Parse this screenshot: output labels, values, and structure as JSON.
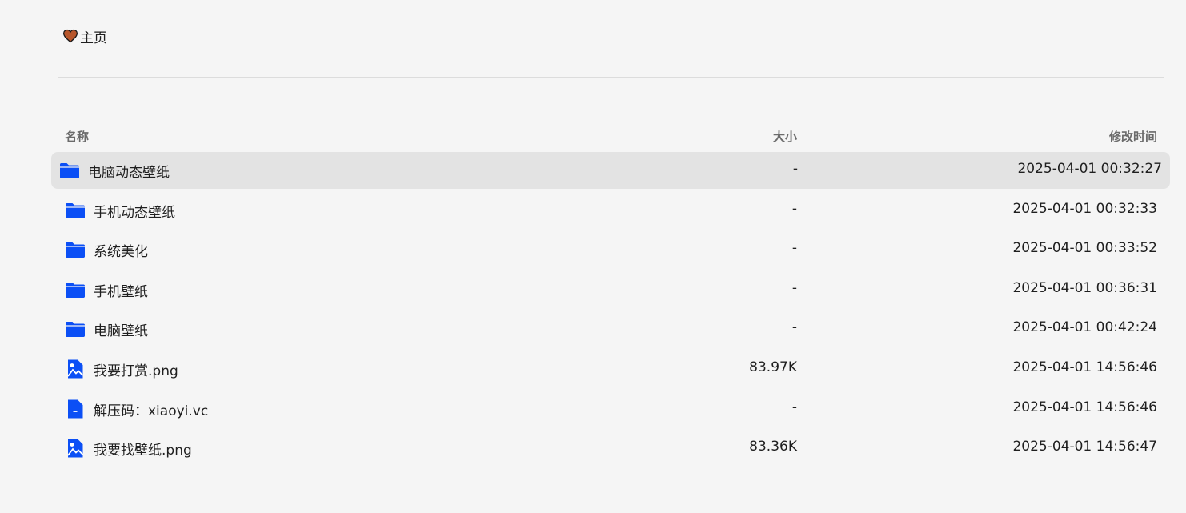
{
  "breadcrumb": {
    "home_label": "主页",
    "home_icon": "heart-icon",
    "heart_color": "#b7562b"
  },
  "table": {
    "headers": {
      "name": "名称",
      "size": "大小",
      "modified": "修改时间"
    },
    "rows": [
      {
        "type": "folder",
        "icon": "folder-icon",
        "name": "电脑动态壁纸",
        "size": "-",
        "modified": "2025-04-01 00:32:27",
        "active": true
      },
      {
        "type": "folder",
        "icon": "folder-icon",
        "name": "手机动态壁纸",
        "size": "-",
        "modified": "2025-04-01 00:32:33"
      },
      {
        "type": "folder",
        "icon": "folder-icon",
        "name": "系统美化",
        "size": "-",
        "modified": "2025-04-01 00:33:52"
      },
      {
        "type": "folder",
        "icon": "folder-icon",
        "name": "手机壁纸",
        "size": "-",
        "modified": "2025-04-01 00:36:31"
      },
      {
        "type": "folder",
        "icon": "folder-icon",
        "name": "电脑壁纸",
        "size": "-",
        "modified": "2025-04-01 00:42:24"
      },
      {
        "type": "image",
        "icon": "image-file-icon",
        "name": "我要打赏.png",
        "size": "83.97K",
        "modified": "2025-04-01 14:56:46"
      },
      {
        "type": "file",
        "icon": "document-file-icon",
        "name": "解压码：xiaoyi.vc",
        "size": "-",
        "modified": "2025-04-01 14:56:46"
      },
      {
        "type": "image",
        "icon": "image-file-icon",
        "name": "我要找壁纸.png",
        "size": "83.36K",
        "modified": "2025-04-01 14:56:47"
      }
    ]
  },
  "colors": {
    "icon_blue": "#0b4ff5",
    "background": "#f5f5f5",
    "active_row": "#e3e3e3",
    "header_text": "#6b6b6b"
  }
}
